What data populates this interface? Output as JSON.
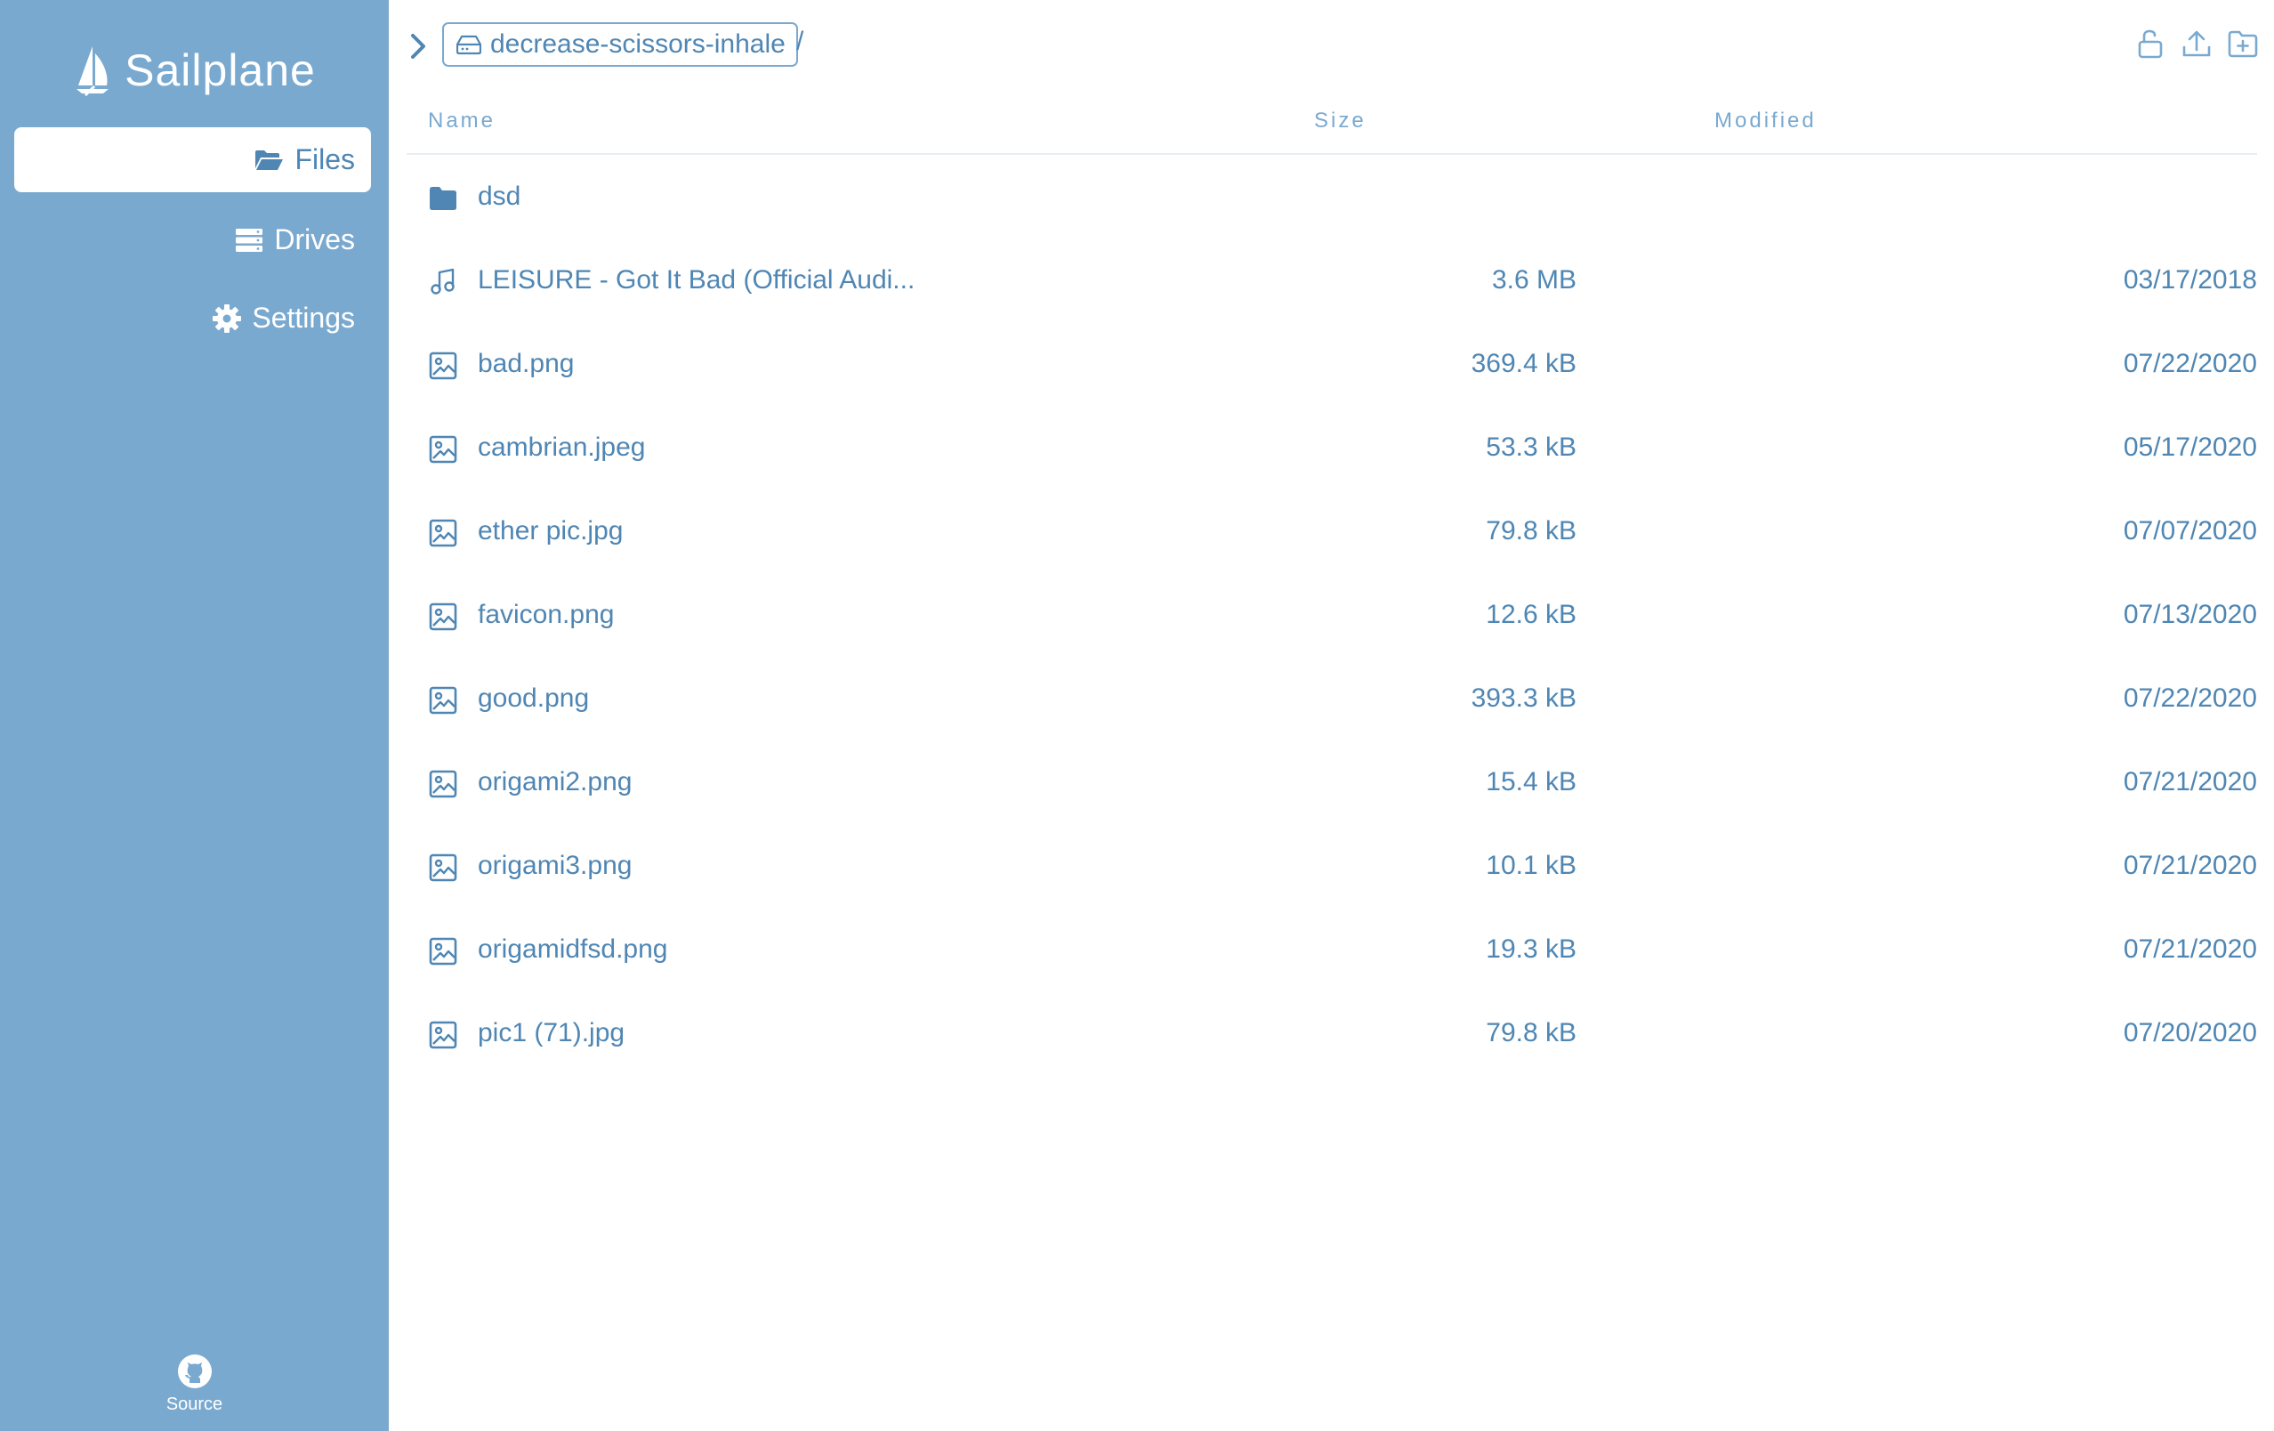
{
  "brand": {
    "name": "Sailplane"
  },
  "nav": {
    "files": "Files",
    "drives": "Drives",
    "settings": "Settings"
  },
  "footer": {
    "source": "Source"
  },
  "breadcrumb": {
    "drive": "decrease-scissors-inhale",
    "separator": "/"
  },
  "columns": {
    "name": "Name",
    "size": "Size",
    "modified": "Modified"
  },
  "colors": {
    "sidebar": "#7aa9d0",
    "accent": "#4f86b3",
    "divider": "#e8eef4"
  },
  "rows": [
    {
      "type": "folder",
      "name": "dsd",
      "size": "",
      "modified": ""
    },
    {
      "type": "audio",
      "name": "LEISURE - Got It Bad (Official Audi...",
      "size": "3.6 MB",
      "modified": "03/17/2018"
    },
    {
      "type": "image",
      "name": "bad.png",
      "size": "369.4 kB",
      "modified": "07/22/2020"
    },
    {
      "type": "image",
      "name": "cambrian.jpeg",
      "size": "53.3 kB",
      "modified": "05/17/2020"
    },
    {
      "type": "image",
      "name": "ether pic.jpg",
      "size": "79.8 kB",
      "modified": "07/07/2020"
    },
    {
      "type": "image",
      "name": "favicon.png",
      "size": "12.6 kB",
      "modified": "07/13/2020"
    },
    {
      "type": "image",
      "name": "good.png",
      "size": "393.3 kB",
      "modified": "07/22/2020"
    },
    {
      "type": "image",
      "name": "origami2.png",
      "size": "15.4 kB",
      "modified": "07/21/2020"
    },
    {
      "type": "image",
      "name": "origami3.png",
      "size": "10.1 kB",
      "modified": "07/21/2020"
    },
    {
      "type": "image",
      "name": "origamidfsd.png",
      "size": "19.3 kB",
      "modified": "07/21/2020"
    },
    {
      "type": "image",
      "name": "pic1 (71).jpg",
      "size": "79.8 kB",
      "modified": "07/20/2020"
    }
  ]
}
